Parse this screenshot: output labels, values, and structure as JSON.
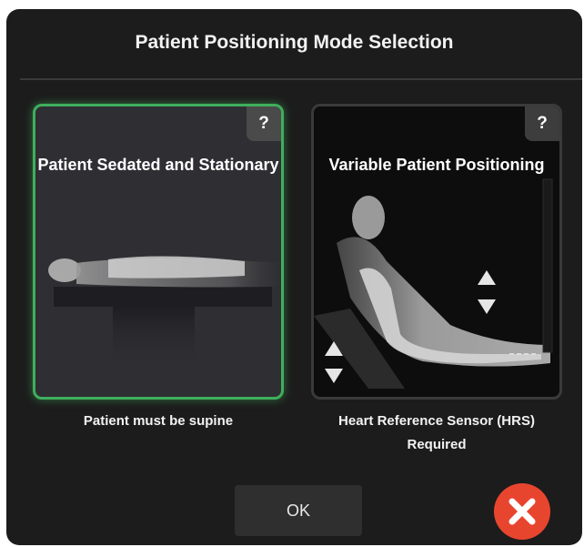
{
  "dialog": {
    "title": "Patient Positioning Mode Selection"
  },
  "options": [
    {
      "title": "Patient Sedated and Stationary",
      "help_label": "?",
      "caption": "Patient must be supine",
      "selected": true
    },
    {
      "title": "Variable Patient Positioning",
      "help_label": "?",
      "caption": "Heart Reference Sensor (HRS) Required",
      "selected": false
    }
  ],
  "footer": {
    "ok_label": "OK",
    "close_icon": "close-x-icon"
  },
  "colors": {
    "background": "#1c1c1c",
    "selected_border": "#3fae5c",
    "close_button": "#e8452f",
    "text": "#f2f2f2"
  }
}
